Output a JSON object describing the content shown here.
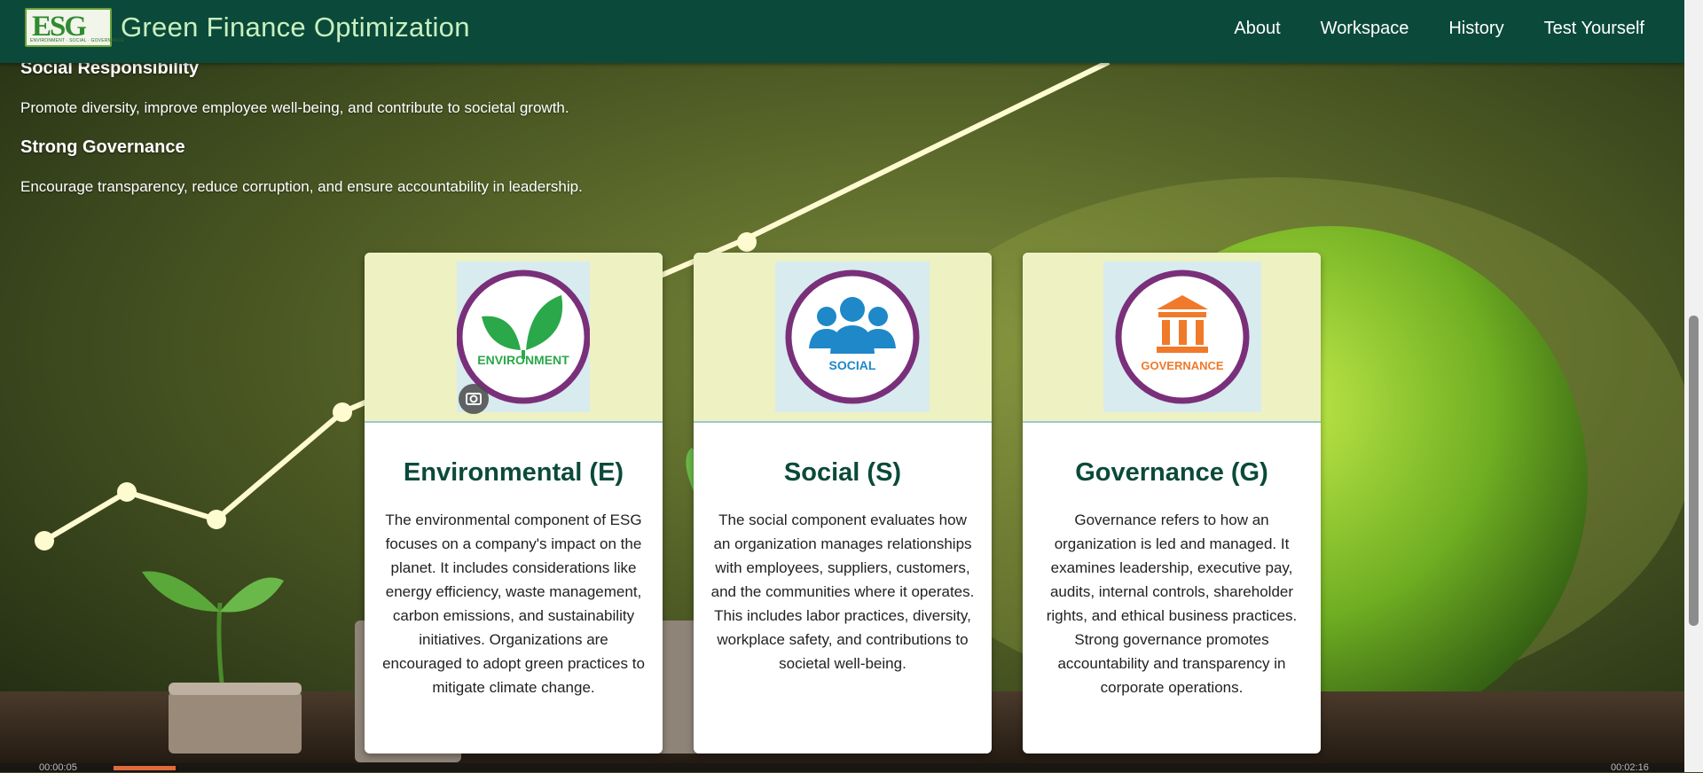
{
  "header": {
    "logo_text": "ESG",
    "logo_subtext": "ENVIRONMENT · SOCIAL · GOVERNANCE",
    "title": "Green Finance Optimization",
    "nav": [
      {
        "label": "About"
      },
      {
        "label": "Workspace"
      },
      {
        "label": "History"
      },
      {
        "label": "Test Yourself"
      }
    ]
  },
  "content": {
    "social_heading": "Social Responsibility",
    "social_text": "Promote diversity, improve employee well-being, and contribute to societal growth.",
    "governance_heading": "Strong Governance",
    "governance_text": "Encourage transparency, reduce corruption, and ensure accountability in leadership."
  },
  "cards": [
    {
      "icon_label": "ENVIRONMENT",
      "title": "Environmental (E)",
      "text": "The environmental component of ESG focuses on a company's impact on the planet. It includes considerations like energy efficiency, waste management, carbon emissions, and sustainability initiatives. Organizations are encouraged to adopt green practices to mitigate climate change."
    },
    {
      "icon_label": "SOCIAL",
      "title": "Social (S)",
      "text": "The social component evaluates how an organization manages relationships with employees, suppliers, customers, and the communities where it operates. This includes labor practices, diversity, workplace safety, and contributions to societal well-being."
    },
    {
      "icon_label": "GOVERNANCE",
      "title": "Governance (G)",
      "text": "Governance refers to how an organization is led and managed. It examines leadership, executive pay, audits, internal controls, shareholder rights, and ethical business practices. Strong governance promotes accountability and transparency in corporate operations."
    }
  ],
  "player": {
    "time_elapsed": "00:00:05",
    "time_total": "00:02:16"
  },
  "colors": {
    "header_bg": "#0b4a3a",
    "title_color": "#c8f0c0",
    "card_top_bg": "#eef2c2",
    "card_title_color": "#0b4a3a",
    "icon_ring": "#7a2f7a",
    "leaf_green": "#2aa84a",
    "people_blue": "#1e88c8",
    "temple_orange": "#f07a2a"
  },
  "icons": [
    "leaf-icon",
    "people-icon",
    "temple-icon",
    "lens-icon"
  ]
}
